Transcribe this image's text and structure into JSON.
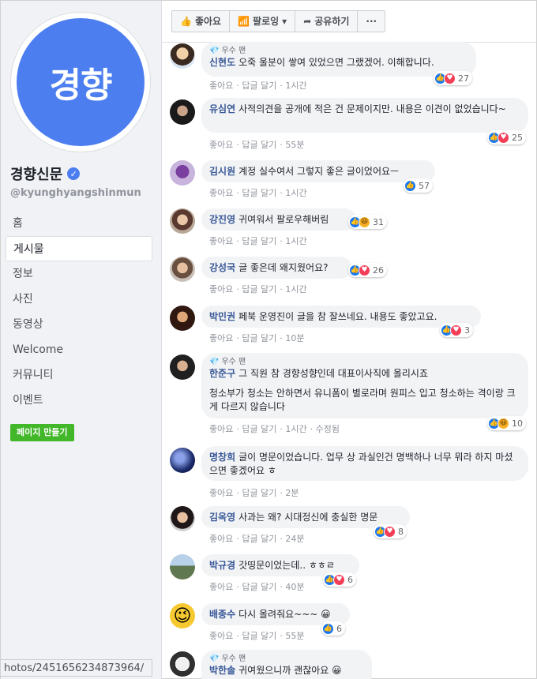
{
  "page": {
    "logo_text": "경향",
    "name": "경향신문",
    "handle": "@kyunghyangshinmun",
    "make_page_label": "페이지 만들기",
    "status_url": "hotos/2451656234873964/"
  },
  "nav": [
    {
      "label": "홈"
    },
    {
      "label": "게시물"
    },
    {
      "label": "정보"
    },
    {
      "label": "사진"
    },
    {
      "label": "동영상"
    },
    {
      "label": "Welcome"
    },
    {
      "label": "커뮤니티"
    },
    {
      "label": "이벤트"
    }
  ],
  "actions": {
    "like": "좋아요",
    "follow": "팔로잉",
    "share": "공유하기",
    "more": "···"
  },
  "comments": [
    {
      "author": "신현도",
      "badge": "우수 팬",
      "text": "오죽 울분이 쌓여 있었으면 그랬겠어. 이해합니다.",
      "like": "좋아요",
      "reply": "답글 달기",
      "time": "1시간",
      "count": "27",
      "reactions": [
        "like",
        "love"
      ]
    },
    {
      "author": "유심연",
      "text": "사적의견을 공개에 적은 건 문제이지만. 내용은 이견이 없었습니다~",
      "like": "좋아요",
      "reply": "답글 달기",
      "time": "55분",
      "count": "25",
      "reactions": [
        "like",
        "love"
      ]
    },
    {
      "author": "김시원",
      "text": "계정 실수여서 그렇지 좋은 글이었어요ㅡ",
      "like": "좋아요",
      "reply": "답글 달기",
      "time": "1시간",
      "count": "57",
      "reactions": [
        "like"
      ]
    },
    {
      "author": "강진영",
      "text": "귀여워서 팔로우해버림",
      "like": "좋아요",
      "reply": "답글 달기",
      "time": "1시간",
      "count": "31",
      "reactions": [
        "like",
        "haha"
      ]
    },
    {
      "author": "강성국",
      "text": "글 좋은데 왜지웠어요?",
      "like": "좋아요",
      "reply": "답글 달기",
      "time": "1시간",
      "count": "26",
      "reactions": [
        "like",
        "love"
      ]
    },
    {
      "author": "박민권",
      "text": "페북 운영진이 글을 참 잘쓰네요. 내용도 좋았고요.",
      "like": "좋아요",
      "reply": "답글 달기",
      "time": "10분",
      "count": "3",
      "reactions": [
        "like",
        "love"
      ]
    },
    {
      "author": "한준구",
      "badge": "우수 팬",
      "text": "그 직원 참 경향성향인데 대표이사직에 올리시죠",
      "text2": "청소부가 청소는 안하면서 유니폼이 별로라며 원피스 입고 청소하는 격이랑 크게 다르지 않습니다",
      "like": "좋아요",
      "reply": "답글 달기",
      "time": "1시간",
      "edited": "수정됨",
      "count": "10",
      "reactions": [
        "like",
        "haha"
      ]
    },
    {
      "author": "명창희",
      "text": "글이 명문이었습니다. 업무 상 과실인건 명백하나 너무 뭐라 하지 마셨으면 좋겠어요 ㅎ",
      "like": "좋아요",
      "reply": "답글 달기",
      "time": "2분"
    },
    {
      "author": "김옥영",
      "text": "사과는 왜? 시대정신에 충실한 명문",
      "like": "좋아요",
      "reply": "답글 달기",
      "time": "24분",
      "count": "8",
      "reactions": [
        "like",
        "love"
      ]
    },
    {
      "author": "박규경",
      "text": "갓띵문이었는데.. ㅎㅎㄹ",
      "like": "좋아요",
      "reply": "답글 달기",
      "time": "40분",
      "count": "6",
      "reactions": [
        "like",
        "love"
      ]
    },
    {
      "author": "배종수",
      "text": "다시 올려줘요~~~ 😀",
      "like": "좋아요",
      "reply": "답글 달기",
      "time": "55분",
      "count": "6",
      "reactions": [
        "like"
      ]
    },
    {
      "author": "박한솔",
      "badge": "우수 팬",
      "text": "귀여웠으니까 괜찮아요 😀"
    }
  ]
}
